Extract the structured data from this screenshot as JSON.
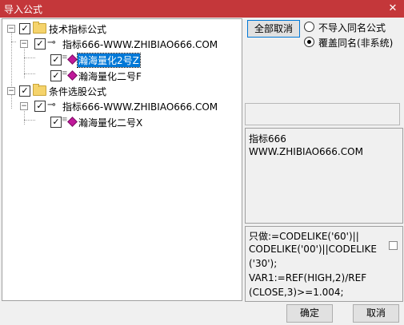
{
  "window": {
    "title": "导入公式",
    "close_glyph": "✕"
  },
  "tree": {
    "check_glyph": "✓",
    "nodes": [
      {
        "expander": "−",
        "label": "技术指标公式",
        "checked": true,
        "icon": "folder-icon"
      },
      {
        "expander": "−",
        "label": "指标666-WWW.ZHIBIAO666.COM",
        "checked": true,
        "icon": "key-icon"
      },
      {
        "label": "瀚海量化2号Z",
        "checked": true,
        "icon": "diamond-icon",
        "selected": true
      },
      {
        "label": "瀚海量化二号F",
        "checked": true,
        "icon": "diamond-icon"
      },
      {
        "expander": "−",
        "label": "条件选股公式",
        "checked": true,
        "icon": "folder-icon"
      },
      {
        "expander": "−",
        "label": "指标666-WWW.ZHIBIAO666.COM",
        "checked": true,
        "icon": "key-icon"
      },
      {
        "label": "瀚海量化二号X",
        "checked": true,
        "icon": "diamond-icon"
      }
    ]
  },
  "options": {
    "deselect_all": "全部取消",
    "radio_skip": "不导入同名公式",
    "radio_overwrite": "覆盖同名(非系统)",
    "selected": "radio_overwrite"
  },
  "info": {
    "line1": "指标666",
    "line2": "WWW.ZHIBIAO666.COM"
  },
  "formula": {
    "lines": [
      "只做:=CODELIKE('60')||",
      "CODELIKE('00')||CODELIKE",
      "('30');",
      "VAR1:=REF(HIGH,2)/REF",
      "(CLOSE,3)>=1.004;"
    ]
  },
  "footer": {
    "ok": "确定",
    "cancel": "取消"
  }
}
